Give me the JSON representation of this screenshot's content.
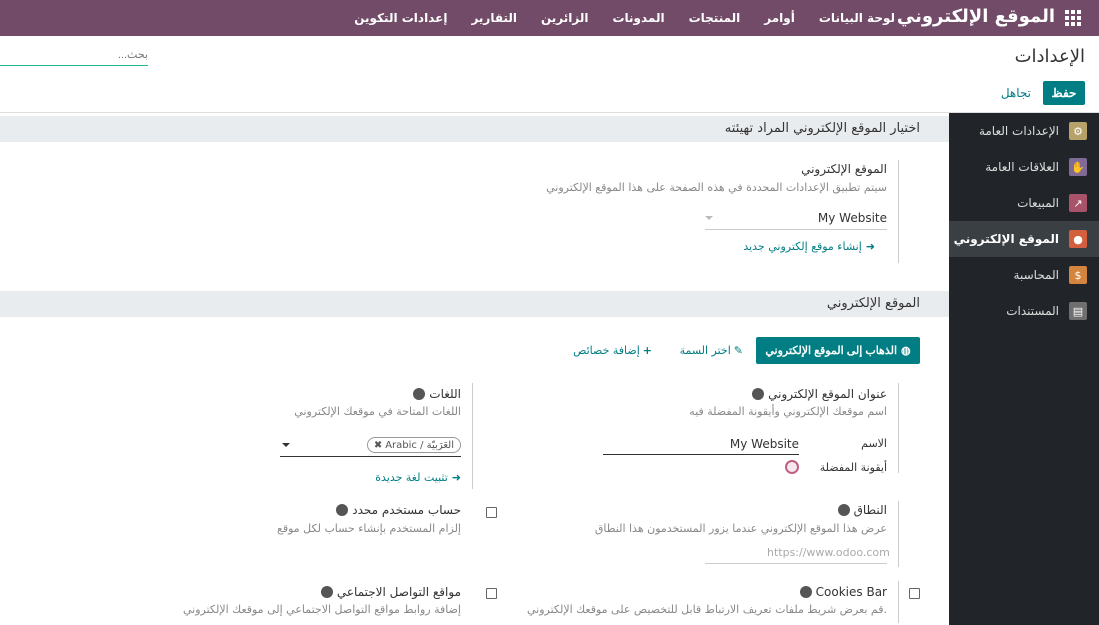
{
  "navbar": {
    "brand": "الموقع الإلكتروني",
    "menu": [
      "لوحة البيانات",
      "أوامر",
      "المنتجات",
      "المدونات",
      "الزائرين",
      "التقارير",
      "إعدادات التكوين"
    ]
  },
  "control_panel": {
    "title": "الإعدادات",
    "search_placeholder": "بحث...",
    "save_label": "حفظ",
    "discard_label": "تجاهل"
  },
  "sidebar": {
    "items": [
      {
        "label": "الإعدادات العامة",
        "icon": "gear-icon",
        "color": "#b6a269"
      },
      {
        "label": "العلاقات العامة",
        "icon": "handshake-icon",
        "color": "#7f6b95"
      },
      {
        "label": "المبيعات",
        "icon": "chart-icon",
        "color": "#a9536b"
      },
      {
        "label": "الموقع الإلكتروني",
        "icon": "globe-icon",
        "color": "#d35f3f"
      },
      {
        "label": "المحاسبة",
        "icon": "invoice-icon",
        "color": "#d3843f"
      },
      {
        "label": "المستندات",
        "icon": "documents-icon",
        "color": "#6f6f6f"
      }
    ],
    "active_index": 3
  },
  "section1": {
    "title": "اختيار الموقع الإلكتروني المراد تهيئته",
    "website_label": "الموقع الإلكتروني",
    "website_desc": "سيتم تطبيق الإعدادات المحددة في هذه الصفحة على هذا الموقع الإلكتروني",
    "website_value": "My Website",
    "create_link": "إنشاء موقع إلكتروني جديد"
  },
  "section2": {
    "title": "الموقع الإلكتروني",
    "goto_button": "الذهاب إلى الموقع الإلكتروني",
    "theme_button": "اختر السمة",
    "add_features_button": "إضافة خصائص",
    "site_title": {
      "label": "عنوان الموقع الإلكتروني",
      "desc": "اسم موقعك الإلكتروني وأيقونة المفضلة فيه",
      "name_label": "الاسم",
      "name_value": "My Website",
      "favicon_label": "أيقونة المفضلة"
    },
    "languages": {
      "label": "اللغات",
      "desc": "اللغات المتاحة في موقعك الإلكتروني",
      "tag": "Arabic / العَرَبيّة",
      "install_link": "تثبيت لغة جديدة"
    },
    "domain": {
      "label": "النطاق",
      "desc": "عرض هذا الموقع الإلكتروني عندما يزور المستخدمون هذا النطاق",
      "placeholder": "https://www.odoo.com"
    },
    "specific_account": {
      "label": "حساب مستخدم محدد",
      "desc": "إلزام المستخدم بإنشاء حساب لكل موقع",
      "checked": false
    },
    "cookies_bar": {
      "label": "Cookies Bar",
      "desc": "قم بعرض شريط ملفات تعريف الارتباط قابل للتخصيص على موقعك الإلكتروني.",
      "checked": false
    },
    "social_media": {
      "label": "مواقع التواصل الاجتماعي",
      "desc": "إضافة روابط مواقع التواصل الاجتماعي إلى موقعك الإلكتروني",
      "checked": false
    }
  }
}
